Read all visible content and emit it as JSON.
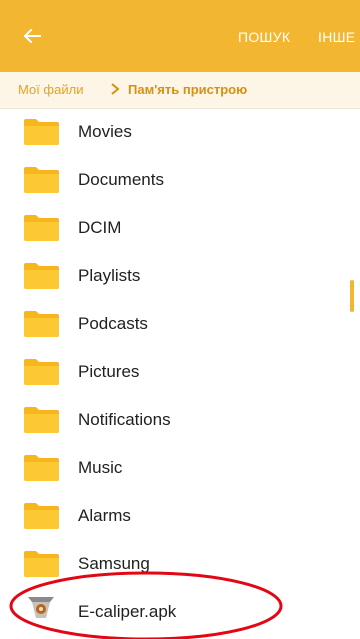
{
  "header": {
    "back_icon": "arrow-left-icon",
    "search_label": "ПОШУК",
    "more_label": "ІНШЕ",
    "accent_color": "#f2b630"
  },
  "breadcrumb": {
    "root": "Мої файли",
    "current": "Пам'ять пристрою",
    "separator_icon": "chevron-right-icon"
  },
  "files": [
    {
      "name": "Movies",
      "type": "folder"
    },
    {
      "name": "Documents",
      "type": "folder"
    },
    {
      "name": "DCIM",
      "type": "folder"
    },
    {
      "name": "Playlists",
      "type": "folder"
    },
    {
      "name": "Podcasts",
      "type": "folder"
    },
    {
      "name": "Pictures",
      "type": "folder"
    },
    {
      "name": "Notifications",
      "type": "folder"
    },
    {
      "name": "Music",
      "type": "folder"
    },
    {
      "name": "Alarms",
      "type": "folder"
    },
    {
      "name": "Samsung",
      "type": "folder"
    },
    {
      "name": "E-caliper.apk",
      "type": "apk"
    }
  ],
  "annotation": {
    "shape": "ellipse",
    "color": "#e30613"
  }
}
